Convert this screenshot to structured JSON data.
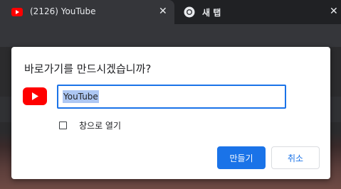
{
  "tabs": [
    {
      "title": "(2126) YouTube",
      "icon": "youtube-icon",
      "active": true
    },
    {
      "title": "새 탭",
      "icon": "chrome-icon",
      "active": false
    }
  ],
  "close_glyph": "✕",
  "dialog": {
    "title": "바로가기를 만드시겠습니까?",
    "app_icon": "youtube-icon",
    "name_value": "YouTube",
    "open_as_window_label": "창으로 열기",
    "create_button": "만들기",
    "cancel_button": "취소"
  },
  "colors": {
    "accent": "#1a73e8",
    "youtube_red": "#ff0000",
    "tab_active_bg": "#35363a",
    "tabstrip_bg": "#202124"
  }
}
